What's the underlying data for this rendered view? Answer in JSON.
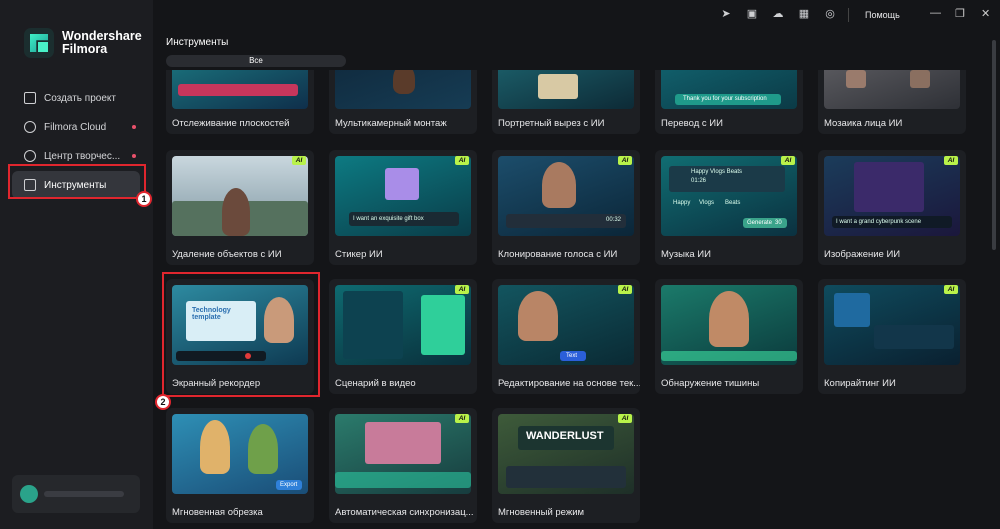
{
  "app": {
    "name_line1": "Wondershare",
    "name_line2": "Filmora"
  },
  "sidebar": {
    "items": [
      {
        "label": "Создать проект",
        "icon": "plus-square-icon",
        "dot": false
      },
      {
        "label": "Filmora Cloud",
        "icon": "cloud-icon",
        "dot": true
      },
      {
        "label": "Центр творчес...",
        "icon": "creator-center-icon",
        "dot": true
      },
      {
        "label": "Инструменты",
        "icon": "toolbox-icon",
        "dot": false,
        "active": true
      }
    ]
  },
  "topbar": {
    "help": "Помощь",
    "icons": [
      "send-icon",
      "media-icon",
      "cloud-upload-icon",
      "grid-icon",
      "headset-icon"
    ]
  },
  "page": {
    "title": "Инструменты",
    "tab_all": "Все"
  },
  "annotations": {
    "badge1": "1",
    "badge2": "2",
    "color": "#e0262e"
  },
  "cards": {
    "r1": [
      "Отслеживание плоскостей",
      "Мультикамерный монтаж",
      "Портретный вырез с ИИ",
      "Перевод с ИИ",
      "Мозаика лица ИИ"
    ],
    "r2": [
      "Удаление объектов с ИИ",
      "Стикер ИИ",
      "Клонирование голоса с ИИ",
      "Музыка ИИ",
      "Изображение ИИ"
    ],
    "r3": [
      "Экранный рекордер",
      "Сценарий в видео",
      "Редактирование на основе тек...",
      "Обнаружение тишины",
      "Копирайтинг ИИ"
    ],
    "r4": [
      "Мгновенная обрезка",
      "Автоматическая синхронизац...",
      "Мгновенный режим"
    ],
    "ai_badge": "AI"
  },
  "thumb_text": {
    "translate_caption": "Thank you for your subscription",
    "sticker_prompt": "I want an exquisite gift box",
    "voice_time": "00:32",
    "music_title": "Happy Vlogs Beats",
    "music_time": "01:26",
    "music_tags": [
      "Happy",
      "Vlogs",
      "Beats"
    ],
    "music_generate": "Generate",
    "music_generate_count": "30",
    "image_prompt": "I want a grand cyberpunk scene",
    "recorder_title": "Technology template",
    "text_chip": "Text",
    "export_label": "Export",
    "wanderlust": "WANDERLUST"
  },
  "colors": {
    "accent": "#b9f24a",
    "sidebar": "#1c1d21",
    "bg": "#141518",
    "active": "#34363c",
    "dot": "#e8516b"
  }
}
